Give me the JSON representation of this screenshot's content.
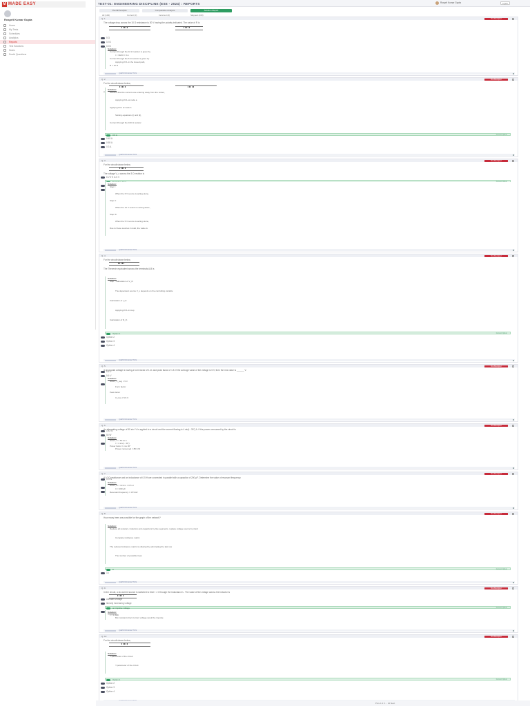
{
  "app": {
    "logo_mark": "M",
    "logo_text": "MADE EASY",
    "page_title": "TEST-01: ENGINEERING DISCIPLINE (ESE - 2024) : REPORTS",
    "user_name": "Rosprit Kumar Gupta",
    "user_sub": "",
    "top_user": "Rosprit Kumar Gupta",
    "top_user_sub": "",
    "top_btn": "Logout"
  },
  "sidebar": {
    "profile_name": "Rosprit Kumar Gupta",
    "profile_sub": "",
    "items": [
      {
        "label": "Home",
        "icon": "home-icon"
      },
      {
        "label": "My Tests",
        "icon": "test-icon"
      },
      {
        "label": "Schedules",
        "icon": "calendar-icon"
      },
      {
        "label": "Analytics",
        "icon": "chart-icon"
      },
      {
        "label": "Reports",
        "icon": "report-icon",
        "active": true
      },
      {
        "label": "Test Solutions",
        "icon": "book-icon"
      },
      {
        "label": "Notes",
        "icon": "note-icon"
      },
      {
        "label": "Doubt Questions",
        "icon": "question-icon"
      }
    ]
  },
  "tabs": [
    "Overall Analysis",
    "Comparative Analysis",
    "Solution Report"
  ],
  "subtabs": [
    "All (100)",
    "Correct (0)",
    "Incorrect (0)",
    "Skipped (100)"
  ],
  "colors": {
    "accent": "#d0342c",
    "correct": "#2f9d62",
    "tag": "#c72b3a"
  },
  "questions": [
    {
      "num": "Q. 1",
      "tag": "Not Attempted",
      "text": "The voltage drop across the 10 Ω resistance is 30 V having the polarity indicated. The value of R is",
      "options": [
        "5 Ω",
        "10 Ω",
        "15 Ω",
        "12 Ω"
      ],
      "correct_index": 3,
      "answer_label": "Correct Option",
      "solution_title": "Solution:",
      "solution_lines": [
        "Current through the 10 Ω resistor is given by",
        "I = 30/10 = 3 A",
        "Current through the 6 Ω resistor is given by",
        "Applying KVL in the closed path,",
        "R = 12 Ω"
      ],
      "footer": "QUESTION ANALYTICS"
    },
    {
      "num": "Q. 2",
      "tag": "Not Attempted",
      "text": "For the circuit shown below,",
      "text2": "The current I in the 100 Ω resistor is",
      "options": [
        "0.6 A",
        "0.45 A",
        "0.65 A",
        "0.3 A"
      ],
      "correct_index": 0,
      "answer_label": "Correct Option",
      "solution_title": "Solution:",
      "solution_lines": [
        "Assume that the currents are entering away from the nodes,",
        "Applying KCL at node a",
        "Applying KCL at node b",
        "Solving equations (i) and (ii),",
        "Current through the 100 Ω resistor"
      ],
      "footer": "QUESTION ANALYTICS"
    },
    {
      "num": "Q. 3",
      "tag": "Not Attempted",
      "text": "For the circuit shown below,",
      "text2": "The voltage V_x across the 3 Ω resistor is",
      "options": [
        "6 V if E is 5 V",
        "8 V if E is 12 V",
        "5 V if E is 6 V",
        "10 V if E is 5 V"
      ],
      "correct_index": 1,
      "answer_label": "Correct Option",
      "solution_title": "Solution:",
      "solution_lines": [
        "Step I:",
        "When the 6 V source is acting alone,",
        "Step II:",
        "When the 12 V source is acting alone,",
        "Step III:",
        "When the 5 V source is acting alone,",
        "Due to these sources in total, the value is"
      ],
      "footer": "QUESTION ANALYTICS"
    },
    {
      "num": "Q. 4",
      "tag": "Not Attempted",
      "text": "For the circuit shown below,",
      "text2": "The Thevenin equivalent across the terminals A-B is",
      "options": [
        "Option 1",
        "Option 2",
        "Option 3",
        "Option 4"
      ],
      "correct_index": 0,
      "answer_label": "Correct Option",
      "solution_title": "Solution:",
      "solution_lines": [
        "Step : Calculation of V_th",
        "The dependent source V_x depends on the controlling variable",
        "Calculation of I_sc",
        "Applying KVL in loop",
        "Calculation of R_th"
      ],
      "footer": "QUESTION ANALYTICS"
    },
    {
      "num": "Q. 5",
      "tag": "Not Attempted",
      "text": "A sinusoidal voltage is having a form factor of 1.11 and peak factor of 1.5. If the average value of the voltage is 5 V, then the rms value is ______ V.",
      "options": [
        "6.6 V",
        "5.6 V",
        "5.5 V",
        "7.5 V"
      ],
      "correct_index": 2,
      "answer_label": "Correct Option",
      "solution_title": "Solution:",
      "solution_lines": [
        "Given,   V_avg = 5 V",
        "Form factor",
        "Peak factor",
        "V_rms = 5.5 V"
      ],
      "footer": "QUESTION ANALYTICS"
    },
    {
      "num": "Q. 6",
      "tag": "Not Attempted",
      "text": "An alternating voltage of 50 sin t V is applied to a circuit and the current flowing is 4 sin(t - 30°) A. If the power consumed by the circuit is",
      "options": [
        "100 W",
        "50 W",
        "86.6 W",
        "173.2 W"
      ],
      "correct_index": 2,
      "answer_label": "Correct Option",
      "solution_title": "Solution:",
      "solution_lines": [
        "Given,   V = 50 sin t",
        "I = 4 sin(t - 30°)",
        "Power factor = cos 30°",
        "Power consumed = 86.6 W"
      ],
      "footer": "QUESTION ANALYTICS"
    },
    {
      "num": "Q. 7",
      "tag": "Not Attempted",
      "text": "A 10 Ω resistance and an inductance of 0.5 H are connected in parallel with a capacitor of 200 μF. Determine the value of resonant frequency",
      "options": [
        "10 Hz",
        "15.9 Hz",
        "12.6 Hz",
        "20 Hz"
      ],
      "correct_index": 1,
      "answer_label": "Correct Option",
      "solution_title": "Solution:",
      "solution_lines": [
        "Given,   R = 10 Ω   L = 0.5 H",
        "C = 200 μF",
        "Resonant frequency = 15.9 Hz"
      ],
      "footer": "QUESTION ANALYTICS"
    },
    {
      "num": "Q. 8",
      "tag": "Not Attempted",
      "text": "How many trees are possible for the graph of the network?",
      "options": [
        "8",
        "16"
      ],
      "correct_index": 0,
      "answer_label": "Correct Option",
      "solution_title": "Solution:",
      "solution_lines": [
        "Replace all resistors, inductors and capacitors by line segments, replace voltage source by short",
        "Complete incidence matrix",
        "The reduced incidence matrix is obtained by eliminating the last row",
        "The number of possible trees"
      ],
      "footer": "QUESTION ANALYTICS"
    },
    {
      "num": "Q. 9",
      "tag": "Not Attempted",
      "text": "In the circuit, a dc current source is switched to time t = 0 through the inductance L. The value of the voltage across the inductor is",
      "options": [
        "constant voltage",
        "linearly increasing voltage",
        "an impulse voltage",
        "an exponentially decaying voltage"
      ],
      "correct_index": 2,
      "answer_label": "Correct Option",
      "solution_title": "Solution:",
      "solution_lines": [
        "v = L di/dt",
        "But constant direct current voltage would be impulse"
      ],
      "footer": "QUESTION ANALYTICS"
    },
    {
      "num": "Q. 10",
      "tag": "Not Attempted",
      "text": "For the circuit shown below,",
      "options": [
        "Option 1",
        "Option 2",
        "Option 3",
        "Option 4"
      ],
      "correct_index": 0,
      "answer_label": "Correct Option",
      "solution_title": "Solution:",
      "solution_lines": [
        "Y-parameter of the circuit",
        "Y-parameter of the circuit"
      ],
      "footer": "QUESTION ANALYTICS"
    }
  ],
  "pager": {
    "label": "Prev  1  2  3  ...  10  Next"
  }
}
